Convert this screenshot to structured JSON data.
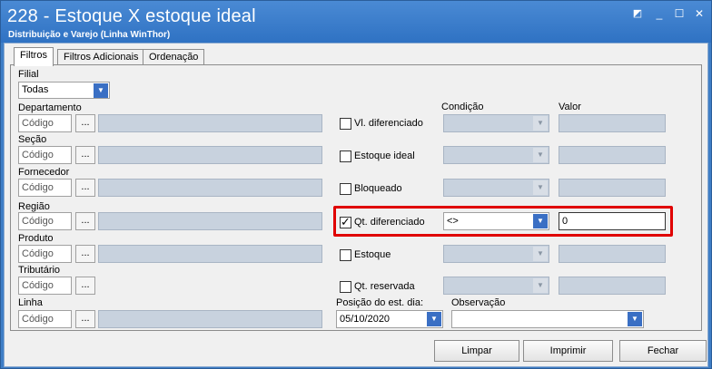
{
  "window": {
    "title": "228 - Estoque X estoque ideal",
    "subtitle": "Distribuição e Varejo (Linha WinThor)"
  },
  "tabs": [
    "Filtros",
    "Filtros Adicionais",
    "Ordenação"
  ],
  "left_filters": {
    "filial_label": "Filial",
    "filial_value": "Todas",
    "code_placeholder": "Código",
    "dots": "...",
    "fields": [
      {
        "label": "Departamento"
      },
      {
        "label": "Seção"
      },
      {
        "label": "Fornecedor"
      },
      {
        "label": "Região"
      },
      {
        "label": "Produto"
      },
      {
        "label": "Tributário"
      },
      {
        "label": "Linha"
      }
    ]
  },
  "right_filters": {
    "condicao_label": "Condição",
    "valor_label": "Valor",
    "rows": [
      {
        "label": "Vl. diferenciado",
        "checked": false,
        "condition": "",
        "value": ""
      },
      {
        "label": "Estoque ideal",
        "checked": false,
        "condition": "",
        "value": ""
      },
      {
        "label": "Bloqueado",
        "checked": false,
        "condition": "",
        "value": ""
      },
      {
        "label": "Qt. diferenciado",
        "checked": true,
        "condition": "<>",
        "value": "0"
      },
      {
        "label": "Estoque",
        "checked": false,
        "condition": "",
        "value": ""
      },
      {
        "label": "Qt. reservada",
        "checked": false,
        "condition": "",
        "value": ""
      }
    ],
    "posicao_label": "Posição do est. dia:",
    "posicao_value": "05/10/2020",
    "observacao_label": "Observação",
    "observacao_value": ""
  },
  "buttons": {
    "limpar": "Limpar",
    "imprimir": "Imprimir",
    "fechar": "Fechar"
  },
  "colors": {
    "highlight": "#e00000",
    "titlebar": "#3f7ec6"
  }
}
